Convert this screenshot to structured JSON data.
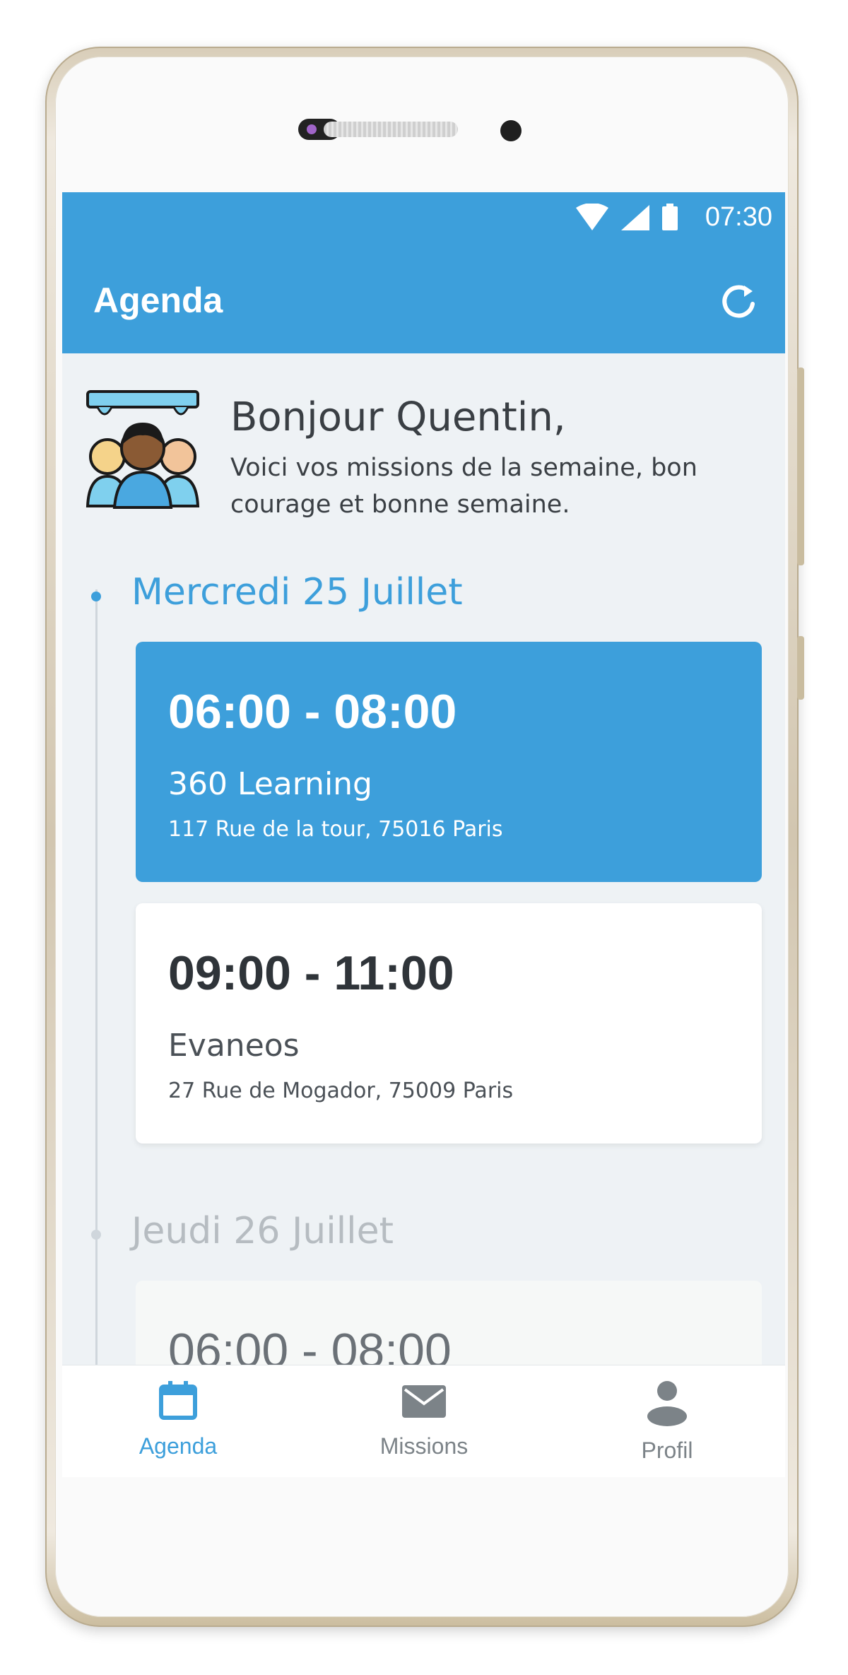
{
  "status_bar": {
    "time": "07:30"
  },
  "app_bar": {
    "title": "Agenda"
  },
  "greeting": {
    "title": "Bonjour Quentin,",
    "subtitle": "Voici vos missions de la semaine, bon courage et bonne semaine."
  },
  "days": [
    {
      "label": "Mercredi 25 Juillet",
      "missions": [
        {
          "time": "06:00 - 08:00",
          "company": "360 Learning",
          "address": "117 Rue de la tour, 75016 Paris",
          "highlighted": true
        },
        {
          "time": "09:00 - 11:00",
          "company": "Evaneos",
          "address": "27 Rue de Mogador, 75009 Paris",
          "highlighted": false
        }
      ]
    },
    {
      "label": "Jeudi 26 Juillet",
      "missions": [
        {
          "time": "06:00 - 08:00"
        }
      ]
    }
  ],
  "bottom_nav": {
    "items": [
      {
        "label": "Agenda",
        "icon": "calendar-icon",
        "active": true
      },
      {
        "label": "Missions",
        "icon": "envelope-icon",
        "active": false
      },
      {
        "label": "Profil",
        "icon": "person-icon",
        "active": false
      }
    ]
  },
  "colors": {
    "primary": "#3d9fdb",
    "background": "#eef2f5",
    "text_dark": "#2f3439",
    "text_muted": "#b6bcc1",
    "nav_inactive": "#7c8388"
  }
}
